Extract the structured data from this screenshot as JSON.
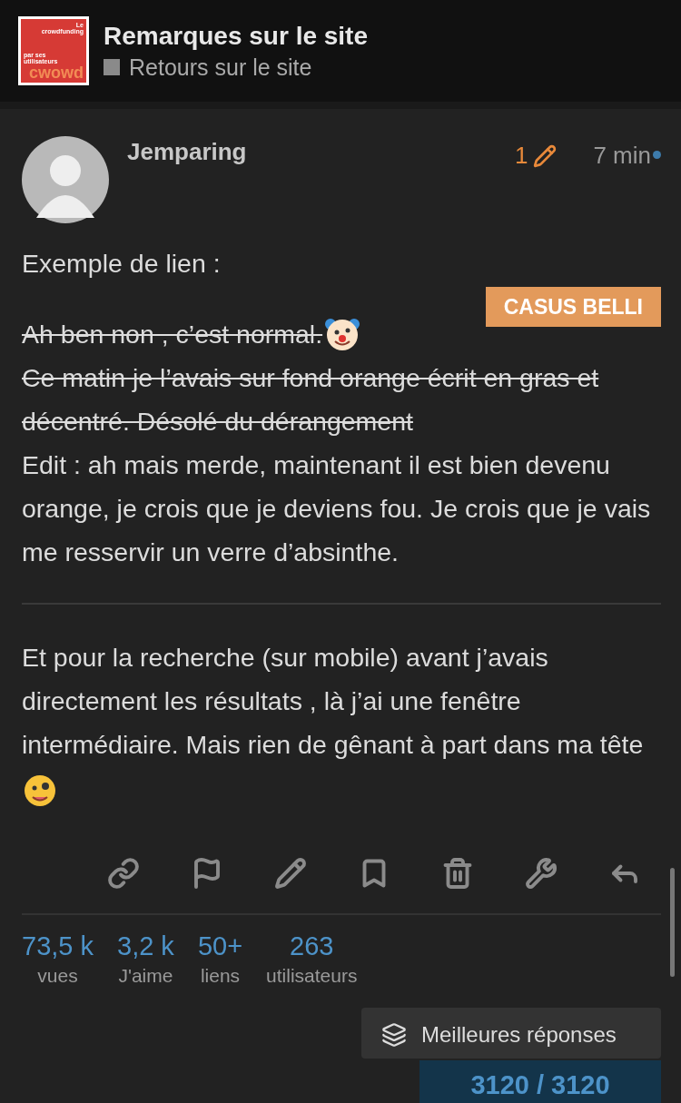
{
  "header": {
    "logo": {
      "line_1": "Le",
      "line_2": "crowdfunding",
      "line_3": "par ses",
      "line_4": "utilisateurs",
      "wordmark": "cwowd"
    },
    "title": "Remarques sur le site",
    "category": {
      "name": "Retours sur le site",
      "color": "#8a8a8a"
    }
  },
  "post": {
    "author": "Jemparing",
    "edits": "1",
    "time": "7 min",
    "unread": true,
    "tag": "CASUS BELLI",
    "intro": "Exemple de lien :",
    "struck_line": "Ah ben non , c’est normal.",
    "struck_text": "Ce matin je l’avais sur fond orange écrit en gras et décentré. Désolé du dérangement",
    "edit_text": "Edit : ah mais merde, maintenant il est bien devenu orange, je crois que je deviens fou. Je crois que je vais me resservir un verre d’absinthe.",
    "second_text": "Et pour la recherche (sur mobile) avant j’avais directement les résultats , là j’ai une fenêtre intermédiaire. Mais rien de gênant à part dans ma tête",
    "actions": [
      {
        "kind": "link"
      },
      {
        "kind": "flag"
      },
      {
        "kind": "edit"
      },
      {
        "kind": "bookmark"
      },
      {
        "kind": "delete"
      },
      {
        "kind": "admin"
      },
      {
        "kind": "reply"
      }
    ]
  },
  "stats": [
    {
      "value": "73,5 k",
      "label": "vues"
    },
    {
      "value": "3,2 k",
      "label": "J'aime"
    },
    {
      "value": "50+",
      "label": "liens"
    },
    {
      "value": "263",
      "label": "utilisateurs"
    }
  ],
  "top_replies_button": "Meilleures réponses",
  "progress": "3120 / 3120"
}
